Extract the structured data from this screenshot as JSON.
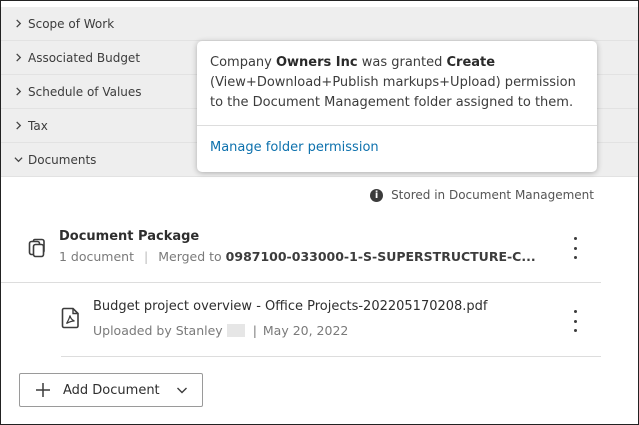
{
  "accordion": [
    {
      "label": "Scope of Work"
    },
    {
      "label": "Associated Budget"
    },
    {
      "label": "Schedule of Values"
    },
    {
      "label": "Tax"
    },
    {
      "label": "Documents"
    }
  ],
  "popover": {
    "prefix": "Company ",
    "company": "Owners Inc",
    "mid": " was granted ",
    "permission": "Create",
    "detail": "(View+Download+Publish markups+Upload) permission",
    "suffix": "to the Document Management folder assigned to them.",
    "link": "Manage folder permission"
  },
  "stored": {
    "icon": "info-icon",
    "text": "Stored in Document Management"
  },
  "package": {
    "icon": "document-package-icon",
    "title": "Document Package",
    "count": "1 document",
    "merged_prefix": "Merged to ",
    "merged_name": "0987100-033000-1-S-SUPERSTRUCTURE-C..."
  },
  "file": {
    "icon": "pdf-file-icon",
    "name": "Budget project overview - Office Projects-202205170208.pdf",
    "uploaded_by": "Uploaded by Stanley",
    "date": "May 20, 2022"
  },
  "add_button": {
    "label": "Add Document"
  },
  "colors": {
    "link": "#0d71ad",
    "accordion_bg": "#eeeeee"
  }
}
